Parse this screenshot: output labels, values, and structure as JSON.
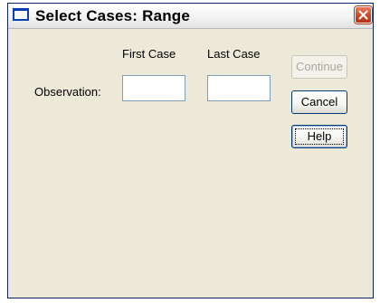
{
  "dialog": {
    "title": "Select Cases: Range",
    "icon": "window-icon",
    "close_icon": "close-icon"
  },
  "fields": {
    "row_label": "Observation:",
    "first_case_header": "First Case",
    "last_case_header": "Last Case",
    "first_case_value": "",
    "last_case_value": ""
  },
  "buttons": {
    "continue_label": "Continue",
    "continue_enabled": false,
    "cancel_label": "Cancel",
    "help_label": "Help"
  },
  "colors": {
    "dialog_background": "#ece9d8",
    "close_button": "#cc4222",
    "disabled_text": "#aca899"
  }
}
